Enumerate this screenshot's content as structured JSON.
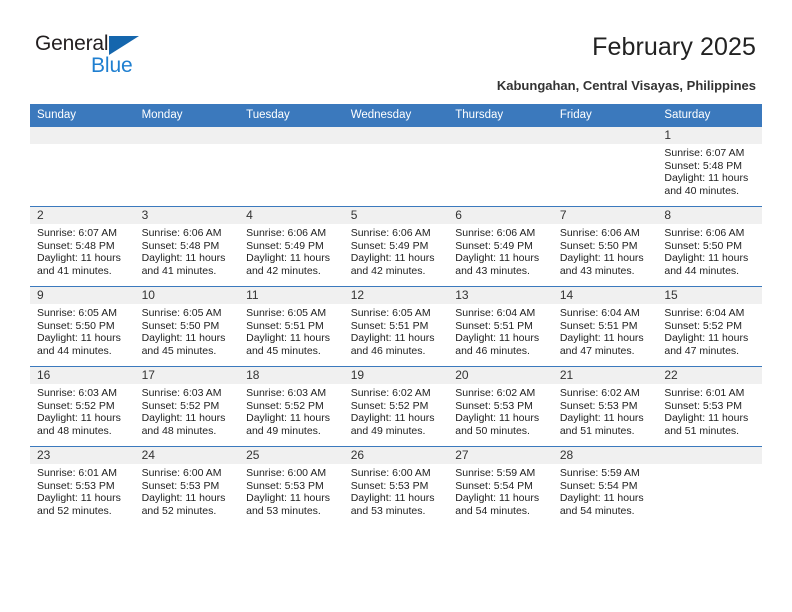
{
  "brand": {
    "name_part1": "General",
    "name_part2": "Blue",
    "triangle_color": "#1566ad",
    "blue_color": "#1f7fd0"
  },
  "header": {
    "title": "February 2025",
    "subtitle": "Kabungahan, Central Visayas, Philippines"
  },
  "theme": {
    "header_blue": "#3b79bd",
    "band_gray": "#f0f0f0",
    "text_dark": "#222222"
  },
  "weekday_headers": [
    "Sunday",
    "Monday",
    "Tuesday",
    "Wednesday",
    "Thursday",
    "Friday",
    "Saturday"
  ],
  "weeks": [
    [
      {
        "day": "",
        "sunrise": "",
        "sunset": "",
        "daylight1": "",
        "daylight2": ""
      },
      {
        "day": "",
        "sunrise": "",
        "sunset": "",
        "daylight1": "",
        "daylight2": ""
      },
      {
        "day": "",
        "sunrise": "",
        "sunset": "",
        "daylight1": "",
        "daylight2": ""
      },
      {
        "day": "",
        "sunrise": "",
        "sunset": "",
        "daylight1": "",
        "daylight2": ""
      },
      {
        "day": "",
        "sunrise": "",
        "sunset": "",
        "daylight1": "",
        "daylight2": ""
      },
      {
        "day": "",
        "sunrise": "",
        "sunset": "",
        "daylight1": "",
        "daylight2": ""
      },
      {
        "day": "1",
        "sunrise": "Sunrise: 6:07 AM",
        "sunset": "Sunset: 5:48 PM",
        "daylight1": "Daylight: 11 hours",
        "daylight2": "and 40 minutes."
      }
    ],
    [
      {
        "day": "2",
        "sunrise": "Sunrise: 6:07 AM",
        "sunset": "Sunset: 5:48 PM",
        "daylight1": "Daylight: 11 hours",
        "daylight2": "and 41 minutes."
      },
      {
        "day": "3",
        "sunrise": "Sunrise: 6:06 AM",
        "sunset": "Sunset: 5:48 PM",
        "daylight1": "Daylight: 11 hours",
        "daylight2": "and 41 minutes."
      },
      {
        "day": "4",
        "sunrise": "Sunrise: 6:06 AM",
        "sunset": "Sunset: 5:49 PM",
        "daylight1": "Daylight: 11 hours",
        "daylight2": "and 42 minutes."
      },
      {
        "day": "5",
        "sunrise": "Sunrise: 6:06 AM",
        "sunset": "Sunset: 5:49 PM",
        "daylight1": "Daylight: 11 hours",
        "daylight2": "and 42 minutes."
      },
      {
        "day": "6",
        "sunrise": "Sunrise: 6:06 AM",
        "sunset": "Sunset: 5:49 PM",
        "daylight1": "Daylight: 11 hours",
        "daylight2": "and 43 minutes."
      },
      {
        "day": "7",
        "sunrise": "Sunrise: 6:06 AM",
        "sunset": "Sunset: 5:50 PM",
        "daylight1": "Daylight: 11 hours",
        "daylight2": "and 43 minutes."
      },
      {
        "day": "8",
        "sunrise": "Sunrise: 6:06 AM",
        "sunset": "Sunset: 5:50 PM",
        "daylight1": "Daylight: 11 hours",
        "daylight2": "and 44 minutes."
      }
    ],
    [
      {
        "day": "9",
        "sunrise": "Sunrise: 6:05 AM",
        "sunset": "Sunset: 5:50 PM",
        "daylight1": "Daylight: 11 hours",
        "daylight2": "and 44 minutes."
      },
      {
        "day": "10",
        "sunrise": "Sunrise: 6:05 AM",
        "sunset": "Sunset: 5:50 PM",
        "daylight1": "Daylight: 11 hours",
        "daylight2": "and 45 minutes."
      },
      {
        "day": "11",
        "sunrise": "Sunrise: 6:05 AM",
        "sunset": "Sunset: 5:51 PM",
        "daylight1": "Daylight: 11 hours",
        "daylight2": "and 45 minutes."
      },
      {
        "day": "12",
        "sunrise": "Sunrise: 6:05 AM",
        "sunset": "Sunset: 5:51 PM",
        "daylight1": "Daylight: 11 hours",
        "daylight2": "and 46 minutes."
      },
      {
        "day": "13",
        "sunrise": "Sunrise: 6:04 AM",
        "sunset": "Sunset: 5:51 PM",
        "daylight1": "Daylight: 11 hours",
        "daylight2": "and 46 minutes."
      },
      {
        "day": "14",
        "sunrise": "Sunrise: 6:04 AM",
        "sunset": "Sunset: 5:51 PM",
        "daylight1": "Daylight: 11 hours",
        "daylight2": "and 47 minutes."
      },
      {
        "day": "15",
        "sunrise": "Sunrise: 6:04 AM",
        "sunset": "Sunset: 5:52 PM",
        "daylight1": "Daylight: 11 hours",
        "daylight2": "and 47 minutes."
      }
    ],
    [
      {
        "day": "16",
        "sunrise": "Sunrise: 6:03 AM",
        "sunset": "Sunset: 5:52 PM",
        "daylight1": "Daylight: 11 hours",
        "daylight2": "and 48 minutes."
      },
      {
        "day": "17",
        "sunrise": "Sunrise: 6:03 AM",
        "sunset": "Sunset: 5:52 PM",
        "daylight1": "Daylight: 11 hours",
        "daylight2": "and 48 minutes."
      },
      {
        "day": "18",
        "sunrise": "Sunrise: 6:03 AM",
        "sunset": "Sunset: 5:52 PM",
        "daylight1": "Daylight: 11 hours",
        "daylight2": "and 49 minutes."
      },
      {
        "day": "19",
        "sunrise": "Sunrise: 6:02 AM",
        "sunset": "Sunset: 5:52 PM",
        "daylight1": "Daylight: 11 hours",
        "daylight2": "and 49 minutes."
      },
      {
        "day": "20",
        "sunrise": "Sunrise: 6:02 AM",
        "sunset": "Sunset: 5:53 PM",
        "daylight1": "Daylight: 11 hours",
        "daylight2": "and 50 minutes."
      },
      {
        "day": "21",
        "sunrise": "Sunrise: 6:02 AM",
        "sunset": "Sunset: 5:53 PM",
        "daylight1": "Daylight: 11 hours",
        "daylight2": "and 51 minutes."
      },
      {
        "day": "22",
        "sunrise": "Sunrise: 6:01 AM",
        "sunset": "Sunset: 5:53 PM",
        "daylight1": "Daylight: 11 hours",
        "daylight2": "and 51 minutes."
      }
    ],
    [
      {
        "day": "23",
        "sunrise": "Sunrise: 6:01 AM",
        "sunset": "Sunset: 5:53 PM",
        "daylight1": "Daylight: 11 hours",
        "daylight2": "and 52 minutes."
      },
      {
        "day": "24",
        "sunrise": "Sunrise: 6:00 AM",
        "sunset": "Sunset: 5:53 PM",
        "daylight1": "Daylight: 11 hours",
        "daylight2": "and 52 minutes."
      },
      {
        "day": "25",
        "sunrise": "Sunrise: 6:00 AM",
        "sunset": "Sunset: 5:53 PM",
        "daylight1": "Daylight: 11 hours",
        "daylight2": "and 53 minutes."
      },
      {
        "day": "26",
        "sunrise": "Sunrise: 6:00 AM",
        "sunset": "Sunset: 5:53 PM",
        "daylight1": "Daylight: 11 hours",
        "daylight2": "and 53 minutes."
      },
      {
        "day": "27",
        "sunrise": "Sunrise: 5:59 AM",
        "sunset": "Sunset: 5:54 PM",
        "daylight1": "Daylight: 11 hours",
        "daylight2": "and 54 minutes."
      },
      {
        "day": "28",
        "sunrise": "Sunrise: 5:59 AM",
        "sunset": "Sunset: 5:54 PM",
        "daylight1": "Daylight: 11 hours",
        "daylight2": "and 54 minutes."
      },
      {
        "day": "",
        "sunrise": "",
        "sunset": "",
        "daylight1": "",
        "daylight2": ""
      }
    ]
  ]
}
